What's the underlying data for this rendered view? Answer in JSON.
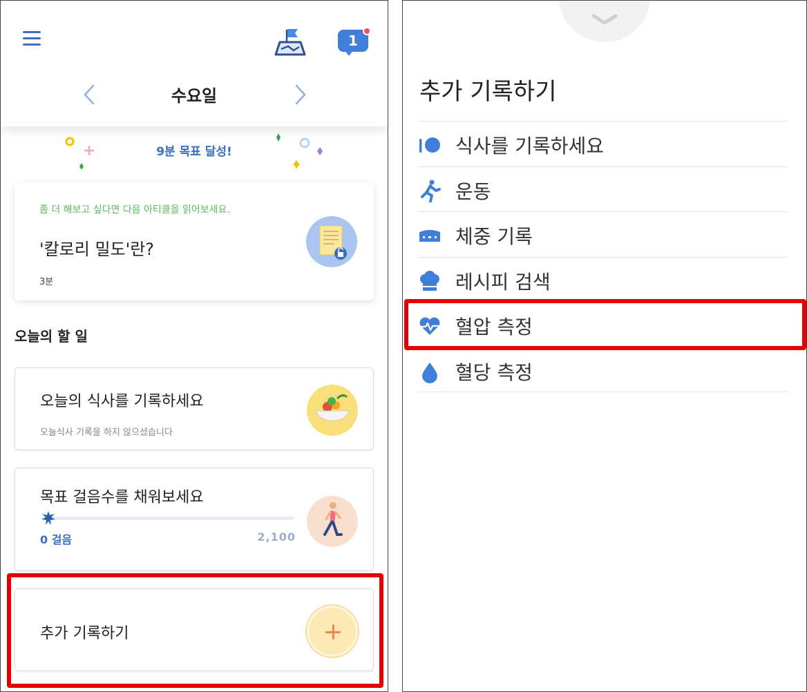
{
  "left": {
    "header": {
      "day": "수요일",
      "notification_count": "1",
      "icons": [
        "menu-icon",
        "map-flag-icon",
        "chat-notification-icon",
        "chevron-left-icon",
        "chevron-right-icon"
      ]
    },
    "goal_banner": "9분 목표 달성!",
    "article": {
      "hint": "좀 더 해보고 싶다면 다음 아티클을 읽어보세요.",
      "title": "'칼로리 밀도'란?",
      "duration": "3분"
    },
    "section_title": "오늘의 할 일",
    "tasks": {
      "meal": {
        "title": "오늘의 식사를 기록하세요",
        "subtitle": "오늘식사 기록을 하지 않으셨습니다"
      },
      "steps": {
        "title": "목표 걸음수를 채워보세요",
        "current": "0 걸음",
        "goal": "2,100",
        "progress": 0
      },
      "add": {
        "title": "추가 기록하기"
      }
    },
    "highlight_color": "#e60000"
  },
  "right": {
    "sheet_title": "추가 기록하기",
    "items": [
      {
        "label": "식사를 기록하세요",
        "icon": "utensils-icon"
      },
      {
        "label": "운동",
        "icon": "running-icon"
      },
      {
        "label": "체중 기록",
        "icon": "scale-icon"
      },
      {
        "label": "레시피 검색",
        "icon": "chef-hat-icon"
      },
      {
        "label": "혈압 측정",
        "icon": "heart-pulse-icon"
      },
      {
        "label": "혈당 측정",
        "icon": "blood-drop-icon"
      }
    ],
    "highlighted_item": "혈압 측정"
  },
  "colors": {
    "accent": "#3f6fb8",
    "icon_blue": "#3f7fd9",
    "green_hint": "#5cba5c",
    "highlight": "#e60000"
  }
}
